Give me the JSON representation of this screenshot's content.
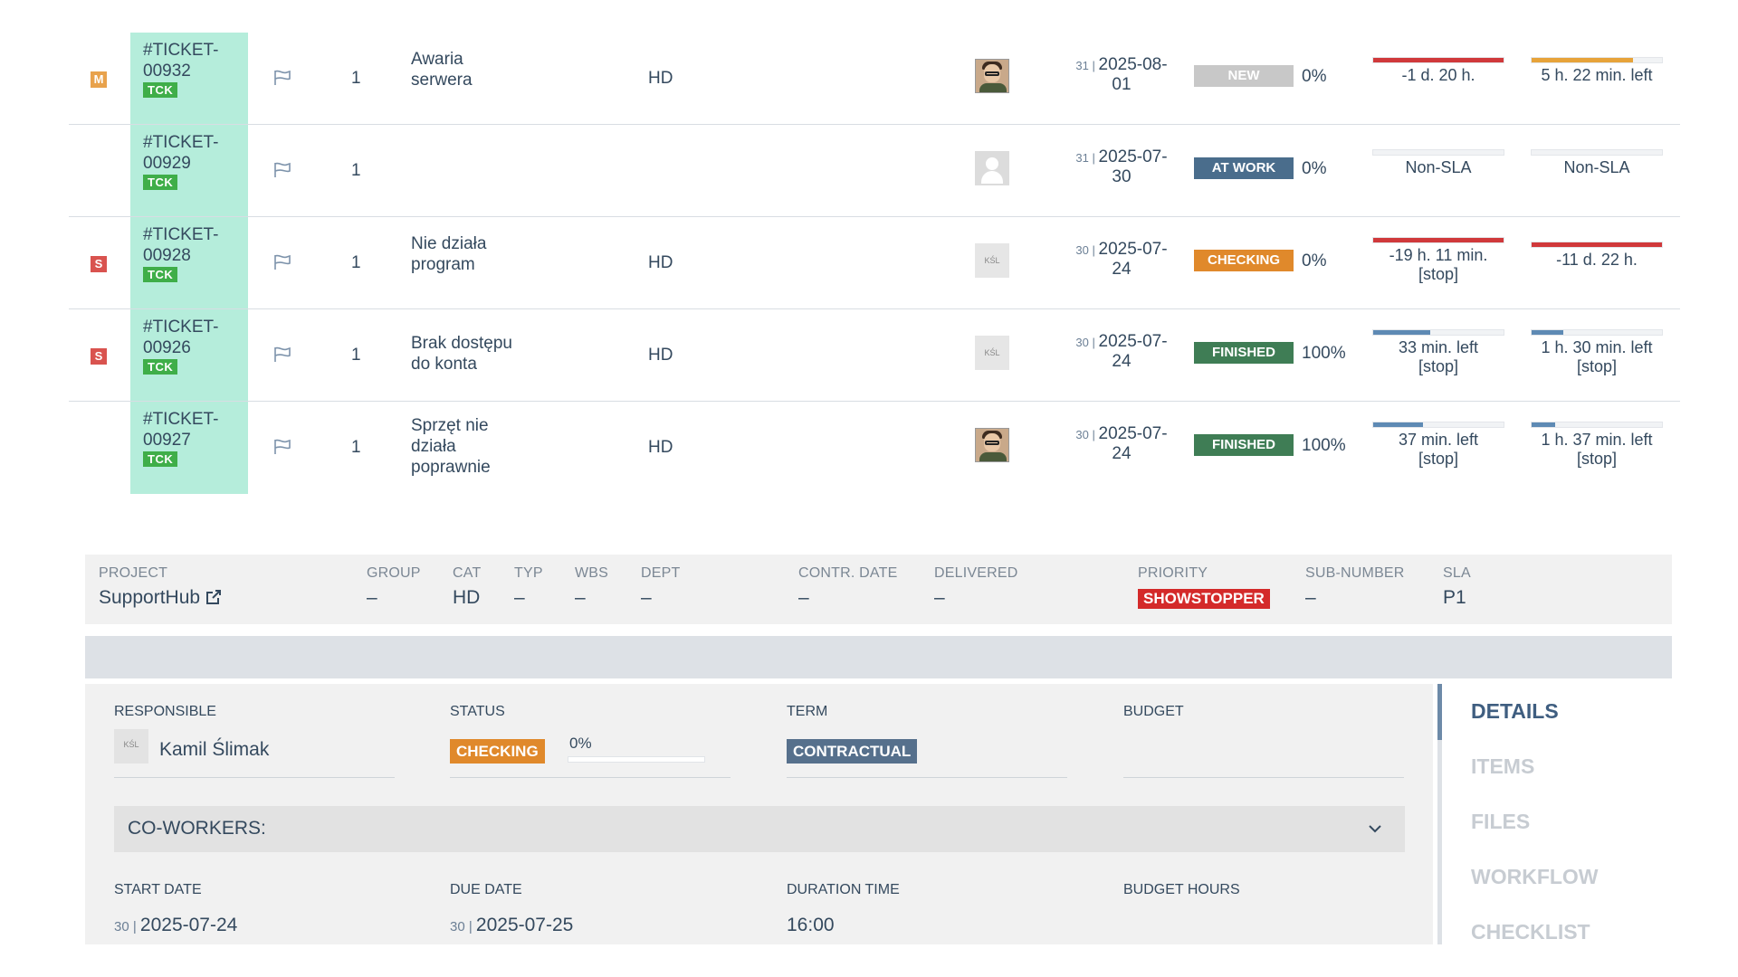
{
  "tickets": [
    {
      "prio": "M",
      "id_line1": "#TICKET-",
      "id_line2": "00932",
      "tag": "TCK",
      "qty": "1",
      "title_line1": "Awaria",
      "title_line2": "serwera",
      "title_line3": "",
      "cat": "HD",
      "day": "31",
      "date_line1": "2025-08-",
      "date_line2": "01",
      "status": "NEW",
      "pct": "0%",
      "sla1": "-1 d. 20 h.",
      "sla1_sub": "",
      "sla2": "5 h. 22 min. left",
      "sla2_sub": ""
    },
    {
      "prio": "",
      "id_line1": "#TICKET-",
      "id_line2": "00929",
      "tag": "TCK",
      "qty": "1",
      "title_line1": "",
      "title_line2": "",
      "title_line3": "",
      "cat": "",
      "day": "31",
      "date_line1": "2025-07-",
      "date_line2": "30",
      "status": "AT WORK",
      "pct": "0%",
      "sla1": "Non-SLA",
      "sla1_sub": "",
      "sla2": "Non-SLA",
      "sla2_sub": ""
    },
    {
      "prio": "S",
      "id_line1": "#TICKET-",
      "id_line2": "00928",
      "tag": "TCK",
      "qty": "1",
      "title_line1": "Nie działa",
      "title_line2": "program",
      "title_line3": "",
      "cat": "HD",
      "day": "30",
      "date_line1": "2025-07-",
      "date_line2": "24",
      "status": "CHECKING",
      "pct": "0%",
      "sla1": "-19 h. 11 min.",
      "sla1_sub": "[stop]",
      "sla2": "-11 d. 22 h.",
      "sla2_sub": ""
    },
    {
      "prio": "S",
      "id_line1": "#TICKET-",
      "id_line2": "00926",
      "tag": "TCK",
      "qty": "1",
      "title_line1": "Brak dostępu",
      "title_line2": "do konta",
      "title_line3": "",
      "cat": "HD",
      "day": "30",
      "date_line1": "2025-07-",
      "date_line2": "24",
      "status": "FINISHED",
      "pct": "100%",
      "sla1": "33 min. left",
      "sla1_sub": "[stop]",
      "sla2": "1 h. 30 min. left",
      "sla2_sub": "[stop]"
    },
    {
      "prio": "",
      "id_line1": "#TICKET-",
      "id_line2": "00927",
      "tag": "TCK",
      "qty": "1",
      "title_line1": "Sprzęt nie",
      "title_line2": "działa",
      "title_line3": "poprawnie",
      "cat": "HD",
      "day": "30",
      "date_line1": "2025-07-",
      "date_line2": "24",
      "status": "FINISHED",
      "pct": "100%",
      "sla1": "37 min. left",
      "sla1_sub": "[stop]",
      "sla2": "1 h. 37 min. left",
      "sla2_sub": "[stop]"
    }
  ],
  "sla_progress": {
    "rows": [
      {
        "sla1_fill": 1.0,
        "sla1_color": "#d0393b",
        "sla2_fill": 0.78,
        "sla2_color": "#e7a33a"
      },
      {
        "sla1_fill": 0,
        "sla1_color": "#d0393b",
        "sla2_fill": 0,
        "sla2_color": "#d0393b"
      },
      {
        "sla1_fill": 1.0,
        "sla1_color": "#d0393b",
        "sla2_fill": 1.0,
        "sla2_color": "#d0393b"
      },
      {
        "sla1_fill": 0.44,
        "sla1_color": "#5e8ab4",
        "sla2_fill": 0.24,
        "sla2_color": "#5e8ab4"
      },
      {
        "sla1_fill": 0.38,
        "sla1_color": "#5e8ab4",
        "sla2_fill": 0.18,
        "sla2_color": "#5e8ab4"
      }
    ]
  },
  "project": {
    "project_label": "PROJECT",
    "project_value": "SupportHub",
    "group_label": "GROUP",
    "group_value": "–",
    "cat_label": "CAT",
    "cat_value": "HD",
    "typ_label": "TYP",
    "typ_value": "–",
    "wbs_label": "WBS",
    "wbs_value": "–",
    "dept_label": "DEPT",
    "dept_value": "–",
    "contr_label": "CONTR. DATE",
    "contr_value": "–",
    "delivered_label": "DELIVERED",
    "delivered_value": "–",
    "priority_label": "PRIORITY",
    "priority_value": "SHOWSTOPPER",
    "sub_label": "SUB-NUMBER",
    "sub_value": "–",
    "sla_label": "SLA",
    "sla_value": "P1"
  },
  "detail": {
    "responsible_label": "RESPONSIBLE",
    "responsible_initials": "KŚL",
    "responsible_name": "Kamil Ślimak",
    "status_label": "STATUS",
    "status_value": "CHECKING",
    "status_pct": "0%",
    "term_label": "TERM",
    "term_value": "CONTRACTUAL",
    "budget_label": "BUDGET",
    "coworkers_label": "CO-WORKERS:",
    "start_label": "START DATE",
    "start_day": "30",
    "start_value": "2025-07-24",
    "due_label": "DUE DATE",
    "due_day": "30",
    "due_value": "2025-07-25",
    "duration_label": "DURATION TIME",
    "duration_value": "16:00",
    "budget_hours_label": "BUDGET HOURS"
  },
  "tabs": [
    "DETAILS",
    "ITEMS",
    "FILES",
    "WORKFLOW",
    "CHECKLIST"
  ],
  "colors": {
    "ticket_bg": "#b5eddb",
    "new": "#c8c8c8",
    "at_work": "#4a6d8c",
    "checking": "#e0892b",
    "finished": "#3f7d55",
    "showstopper": "#d42a2a"
  }
}
